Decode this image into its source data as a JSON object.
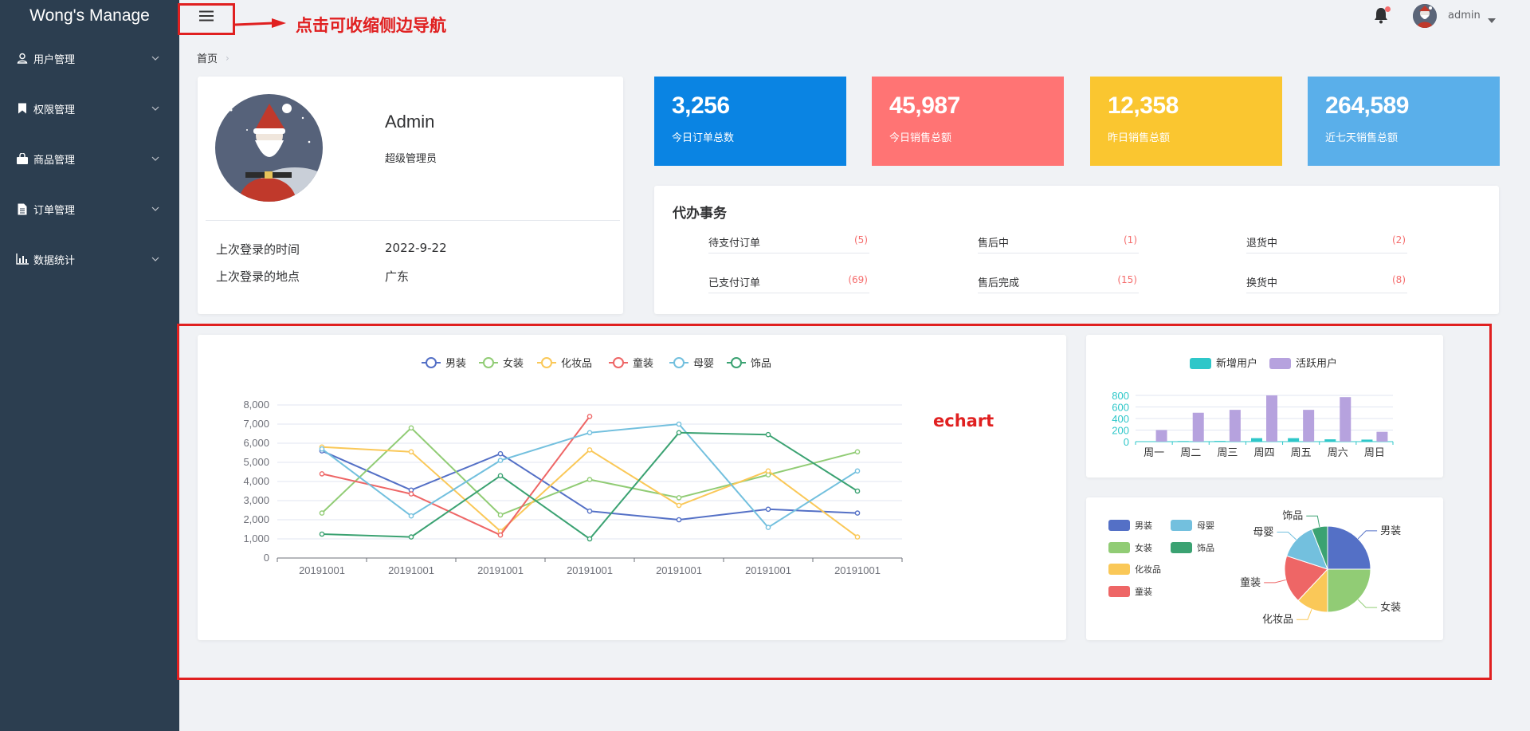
{
  "app": {
    "brand": "Wong's Manage"
  },
  "sidebar": {
    "items": [
      {
        "label": "用户管理",
        "icon": "user-icon"
      },
      {
        "label": "权限管理",
        "icon": "bookmark-icon"
      },
      {
        "label": "商品管理",
        "icon": "shopping-bag-icon"
      },
      {
        "label": "订单管理",
        "icon": "document-icon"
      },
      {
        "label": "数据统计",
        "icon": "bar-chart-icon"
      }
    ]
  },
  "header": {
    "menu_icon": "hamburger-icon",
    "notification_icon": "bell-icon",
    "user_name": "admin"
  },
  "annotations": {
    "collapse_hint": "点击可收缩侧边导航",
    "echart_label": "echart",
    "color": "#e02020"
  },
  "breadcrumb": {
    "home": "首页"
  },
  "profile": {
    "name": "Admin",
    "role": "超级管理员",
    "last_login_time_label": "上次登录的时间",
    "last_login_time": "2022-9-22",
    "last_login_place_label": "上次登录的地点",
    "last_login_place": "广东"
  },
  "stats": [
    {
      "value": "3,256",
      "label": "今日订单总数",
      "color": "#0a84e3"
    },
    {
      "value": "45,987",
      "label": "今日销售总额",
      "color": "#ff7474"
    },
    {
      "value": "12,358",
      "label": "昨日销售总额",
      "color": "#fac630"
    },
    {
      "value": "264,589",
      "label": "近七天销售总额",
      "color": "#5aafea"
    }
  ],
  "todo": {
    "title": "代办事务",
    "items": [
      {
        "label": "待支付订单",
        "count": "(5)"
      },
      {
        "label": "售后中",
        "count": "(1)"
      },
      {
        "label": "退货中",
        "count": "(2)"
      },
      {
        "label": "已支付订单",
        "count": "(69)"
      },
      {
        "label": "售后完成",
        "count": "(15)"
      },
      {
        "label": "换货中",
        "count": "(8)"
      }
    ]
  },
  "chart_data": [
    {
      "type": "line",
      "x": [
        "20191001",
        "20191001",
        "20191001",
        "20191001",
        "20191001",
        "20191001",
        "20191001"
      ],
      "ylim": [
        0,
        8000
      ],
      "yticks": [
        "0",
        "1,000",
        "2,000",
        "3,000",
        "4,000",
        "5,000",
        "6,000",
        "7,000",
        "8,000"
      ],
      "legend_position": "top-center",
      "grid": true,
      "series": [
        {
          "name": "男装",
          "color": "#5470c6",
          "values": [
            5600,
            3550,
            5450,
            2450,
            2000,
            2550,
            2350
          ]
        },
        {
          "name": "女装",
          "color": "#91cc75",
          "values": [
            2350,
            6800,
            2250,
            4100,
            3150,
            4350,
            5550
          ]
        },
        {
          "name": "化妆品",
          "color": "#fac858",
          "values": [
            5800,
            5550,
            1400,
            5650,
            2750,
            4550,
            1100
          ]
        },
        {
          "name": "童装",
          "color": "#ee6666",
          "values": [
            4400,
            3350,
            1200,
            7400
          ]
        },
        {
          "name": "母婴",
          "color": "#73c0de",
          "values": [
            5700,
            2200,
            5100,
            6550,
            7000,
            1600,
            4550
          ]
        },
        {
          "name": "饰品",
          "color": "#3ba272",
          "values": [
            1250,
            1100,
            4300,
            1000,
            6550,
            6450,
            3500
          ]
        }
      ]
    },
    {
      "type": "bar",
      "categories": [
        "周一",
        "周二",
        "周三",
        "周四",
        "周五",
        "周六",
        "周日"
      ],
      "ylim": [
        0,
        800
      ],
      "yticks": [
        "0",
        "200",
        "400",
        "600",
        "800"
      ],
      "legend_position": "top-center",
      "series": [
        {
          "name": "新增用户",
          "color": "#2ec7c9",
          "values": [
            5,
            10,
            12,
            60,
            60,
            40,
            35
          ]
        },
        {
          "name": "活跃用户",
          "color": "#b6a2de",
          "values": [
            200,
            500,
            550,
            800,
            550,
            770,
            170
          ]
        }
      ]
    },
    {
      "type": "pie",
      "legend_position": "left",
      "slices": [
        {
          "name": "男装",
          "value": 25,
          "color": "#5470c6"
        },
        {
          "name": "女装",
          "value": 25,
          "color": "#91cc75"
        },
        {
          "name": "化妆品",
          "value": 12,
          "color": "#fac858"
        },
        {
          "name": "童装",
          "value": 18,
          "color": "#ee6666"
        },
        {
          "name": "母婴",
          "value": 14,
          "color": "#73c0de"
        },
        {
          "name": "饰品",
          "value": 6,
          "color": "#3ba272"
        }
      ]
    }
  ]
}
